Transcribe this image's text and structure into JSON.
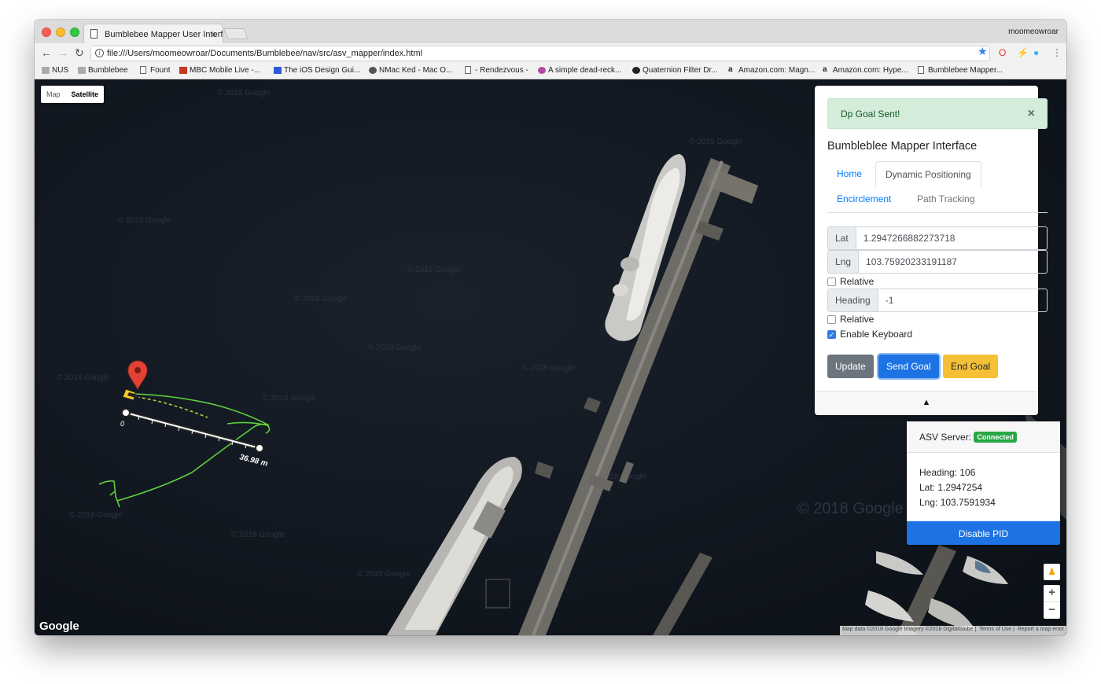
{
  "browser": {
    "tab_title": "Bumblebee Mapper User Interf",
    "profile": "moomeowroar",
    "url": "file:///Users/moomeowroar/Documents/Bumblebee/nav/src/asv_mapper/index.html",
    "bookmarks": [
      "NUS",
      "Bumblebee",
      "Fount",
      "MBC Mobile Live -...",
      "The iOS Design Gui...",
      "NMac Ked - Mac O...",
      "- Rendezvous -",
      "A simple dead-reck...",
      "Quaternion Filter Dr...",
      "Amazon.com: Magn...",
      "Amazon.com: Hype...",
      "Bumblebee Mapper..."
    ]
  },
  "map": {
    "type_buttons": [
      "Map",
      "Satellite"
    ],
    "active_type": "Satellite",
    "watermark": "© 2018 Google",
    "logo": "Google",
    "attribution": [
      "Map data ©2018 Google Imagery ©2018 DigitalGlobe",
      "Terms of Use",
      "Report a map error"
    ],
    "measure_start": "0",
    "measure_label": "36.98 m",
    "zoom_in": "+",
    "zoom_out": "−",
    "path_color": "#5dd13c",
    "marker_color": "#e24234"
  },
  "panel": {
    "alert": "Dp Goal Sent!",
    "alert_close": "×",
    "title": "Bumbleblee Mapper Interface",
    "tabs": [
      "Home",
      "Dynamic Positioning",
      "Encirclement",
      "Path Tracking"
    ],
    "active_tab": "Dynamic Positioning",
    "lat_label": "Lat",
    "lat_value": "1.2947266882273718",
    "lng_label": "Lng",
    "lng_value": "103.75920233191187",
    "relative_label": "Relative",
    "heading_label": "Heading",
    "heading_value": "-1",
    "relative2_label": "Relative",
    "keyboard_label": "Enable Keyboard",
    "keyboard_checked": true,
    "buttons": {
      "update": "Update",
      "send": "Send Goal",
      "end": "End Goal"
    },
    "collapse_icon": "▲"
  },
  "asv": {
    "server_label": "ASV Server:",
    "status": "Connected",
    "heading": "Heading: 106",
    "lat": "Lat: 1.2947254",
    "lng": "Lng: 103.7591934",
    "button": "Disable PID"
  }
}
